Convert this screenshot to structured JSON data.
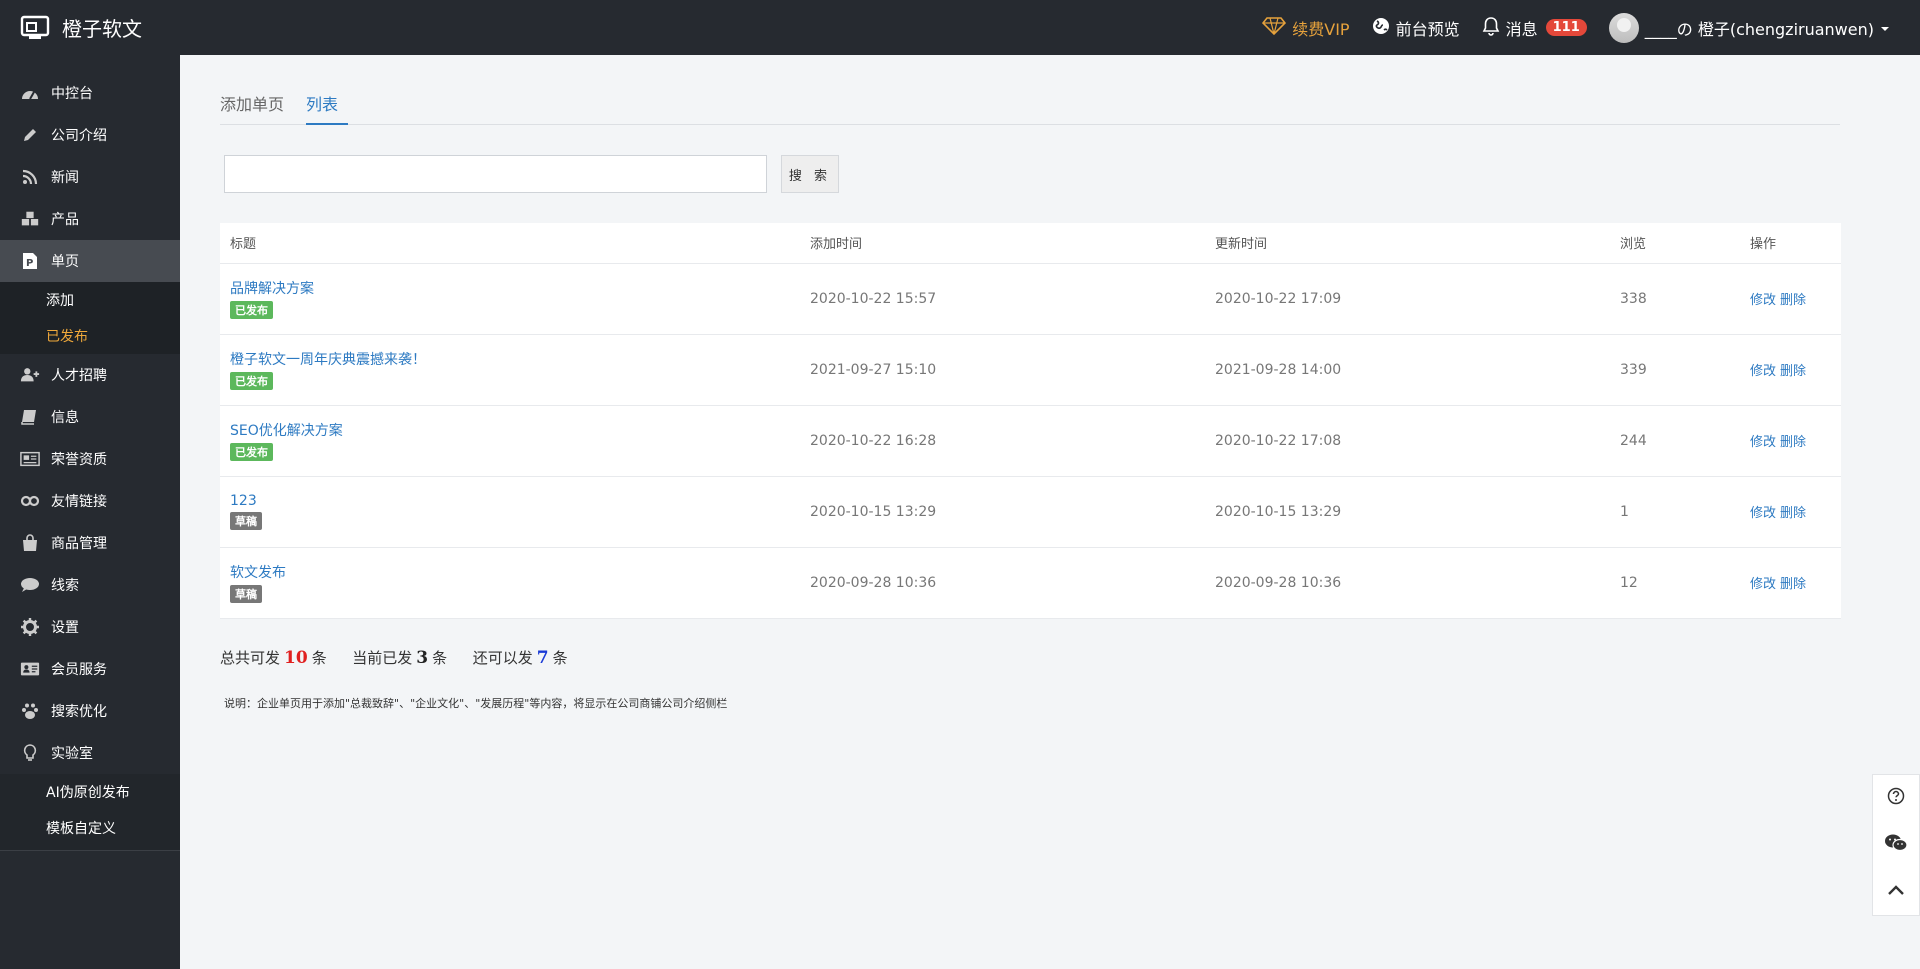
{
  "brand": {
    "name": "橙子软文"
  },
  "topnav": {
    "vip_label": "续费VIP",
    "preview_label": "前台预览",
    "messages_label": "消息",
    "messages_count": "111",
    "user_label": "____の 橙子(chengziruanwen)"
  },
  "sidebar": {
    "items": [
      {
        "label": "中控台",
        "icon": "dashboard-icon"
      },
      {
        "label": "公司介绍",
        "icon": "pencil-icon"
      },
      {
        "label": "新闻",
        "icon": "rss-icon"
      },
      {
        "label": "产品",
        "icon": "cubes-icon"
      },
      {
        "label": "单页",
        "icon": "page-icon"
      },
      {
        "label": "人才招聘",
        "icon": "user-plus-icon"
      },
      {
        "label": "信息",
        "icon": "book-icon"
      },
      {
        "label": "荣誉资质",
        "icon": "newspaper-icon"
      },
      {
        "label": "友情链接",
        "icon": "link-icon"
      },
      {
        "label": "商品管理",
        "icon": "bag-icon"
      },
      {
        "label": "线索",
        "icon": "comment-icon"
      },
      {
        "label": "设置",
        "icon": "gear-icon"
      },
      {
        "label": "会员服务",
        "icon": "id-card-icon"
      },
      {
        "label": "搜索优化",
        "icon": "paw-icon"
      },
      {
        "label": "实验室",
        "icon": "bulb-icon"
      }
    ],
    "single_page_sub": [
      "添加",
      "已发布"
    ],
    "lab_sub": [
      "AI伪原创发布",
      "模板自定义"
    ]
  },
  "tabs": [
    "添加单页",
    "列表"
  ],
  "search": {
    "button_label": "搜 索",
    "value": ""
  },
  "table": {
    "headers": [
      "标题",
      "添加时间",
      "更新时间",
      "浏览",
      "操作"
    ],
    "rows": [
      {
        "title": "品牌解决方案",
        "status": "已发布",
        "added": "2020-10-22 15:57",
        "updated": "2020-10-22 17:09",
        "views": "338"
      },
      {
        "title": "橙子软文一周年庆典震撼来袭！",
        "status": "已发布",
        "added": "2021-09-27 15:10",
        "updated": "2021-09-28 14:00",
        "views": "339"
      },
      {
        "title": "SEO优化解决方案",
        "status": "已发布",
        "added": "2020-10-22 16:28",
        "updated": "2020-10-22 17:08",
        "views": "244"
      },
      {
        "title": "123",
        "status": "草稿",
        "added": "2020-10-15 13:29",
        "updated": "2020-10-15 13:29",
        "views": "1"
      },
      {
        "title": "软文发布",
        "status": "草稿",
        "added": "2020-09-28 10:36",
        "updated": "2020-09-28 10:36",
        "views": "12"
      }
    ],
    "edit_label": "修改",
    "delete_label": "删除"
  },
  "summary": {
    "total_prefix": "总共可发",
    "total": "10",
    "unit": "条",
    "current_prefix": "当前已发",
    "current": "3",
    "remain_prefix": "还可以发",
    "remain": "7"
  },
  "note": "说明：企业单页用于添加\"总裁致辞\"、\"企业文化\"、\"发展历程\"等内容，将显示在公司商铺公司介绍侧栏",
  "colors": {
    "topbar": "#262a30",
    "accent": "#2d7ac2",
    "vip": "#e6a23c",
    "published": "#5cb85c",
    "draft": "#777777",
    "active_sub": "#f0a93b"
  }
}
